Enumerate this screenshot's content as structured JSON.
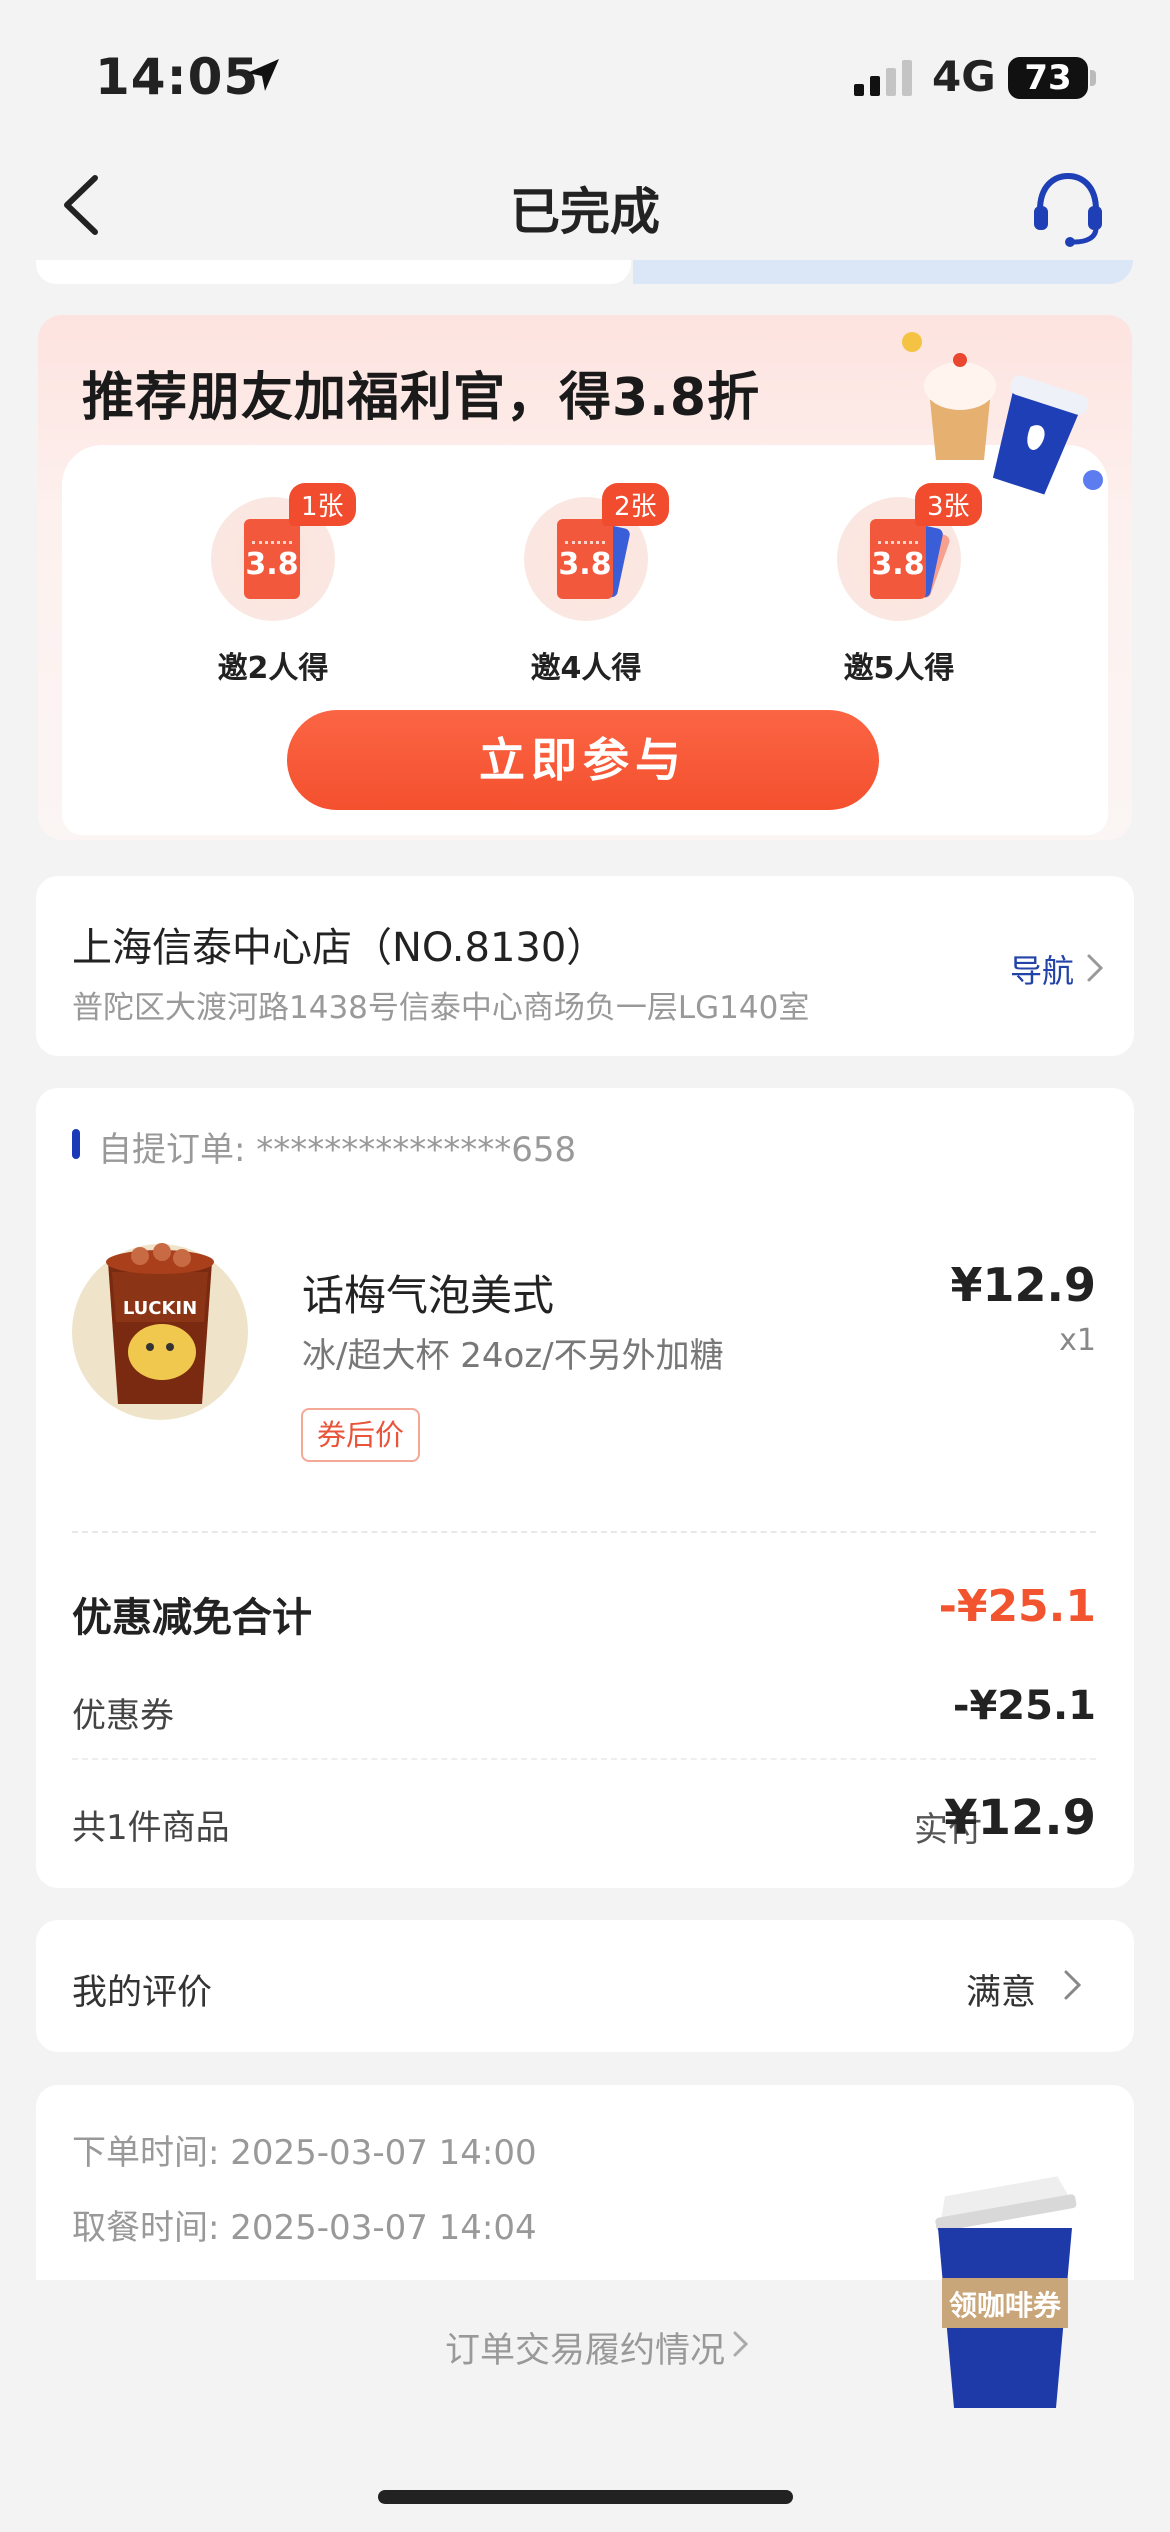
{
  "status_bar": {
    "time": "14:05",
    "network": "4G",
    "battery": "73"
  },
  "nav": {
    "title": "已完成"
  },
  "promo": {
    "title": "推荐朋友加福利官，得3.8折",
    "tiers": [
      {
        "badge": "1张",
        "ticket": "3.8",
        "label": "邀2人得"
      },
      {
        "badge": "2张",
        "ticket": "3.8",
        "label": "邀4人得"
      },
      {
        "badge": "3张",
        "ticket": "3.8",
        "label": "邀5人得"
      }
    ],
    "button": "立即参与"
  },
  "store": {
    "name": "上海信泰中心店（NO.8130）",
    "address": "普陀区大渡河路1438号信泰中心商场负一层LG140室",
    "nav_label": "导航"
  },
  "order": {
    "id_label": "自提订单: ***************658",
    "product": {
      "name": "话梅气泡美式",
      "spec": "冰/超大杯 24oz/不另外加糖",
      "tag": "券后价",
      "price": "¥12.9",
      "qty": "x1"
    },
    "discount_total_label": "优惠减免合计",
    "discount_total_value": "-¥25.1",
    "coupon_label": "优惠券",
    "coupon_value": "-¥25.1",
    "items_label": "共1件商品",
    "paid_label": "实付",
    "paid_value": "¥12.9"
  },
  "review": {
    "label": "我的评价",
    "value": "满意"
  },
  "times": {
    "order_time": "下单时间:  2025-03-07 14:00",
    "pickup_time": "取餐时间:  2025-03-07 14:04"
  },
  "footer": {
    "fulfill_link": "订单交易履约情况"
  },
  "floating": {
    "cup_label": "领咖啡券"
  },
  "colors": {
    "accent": "#f4502e",
    "brand_blue": "#1a3ab8",
    "background": "#f3f3f3"
  }
}
